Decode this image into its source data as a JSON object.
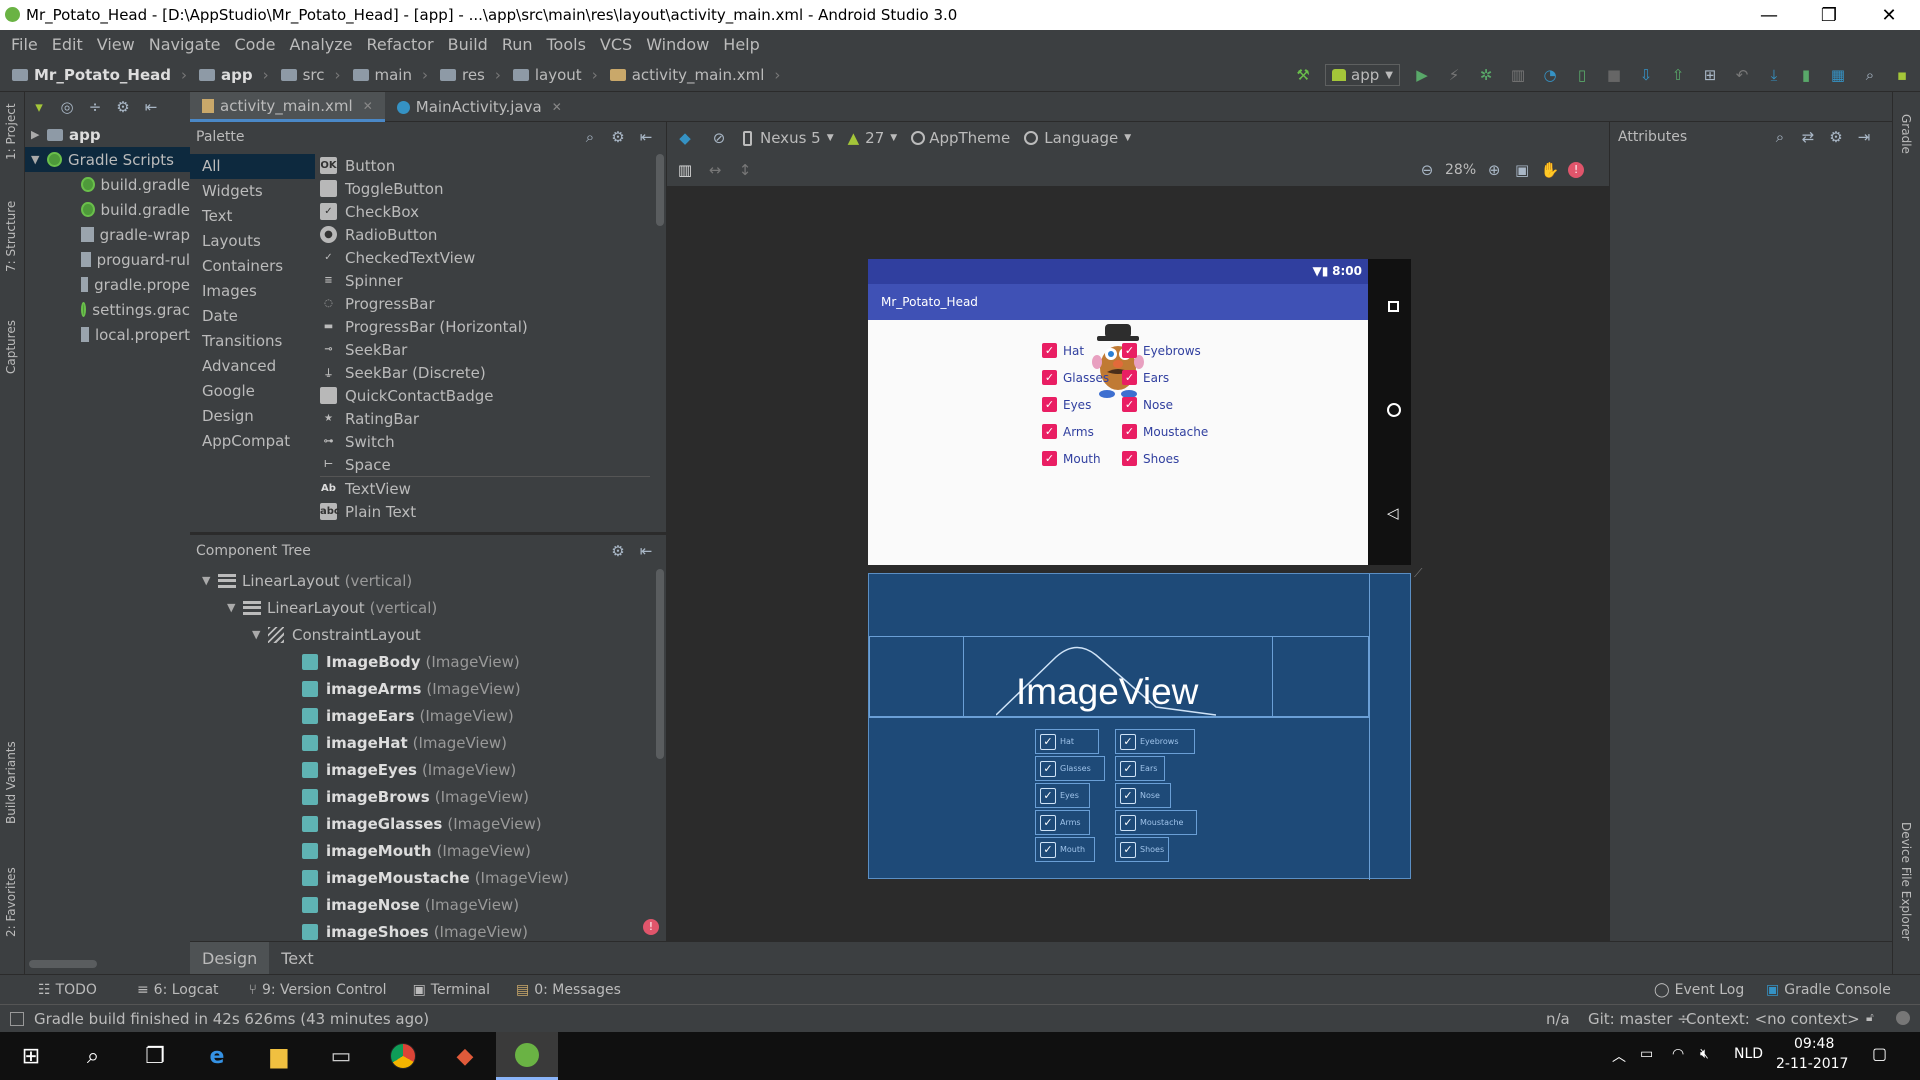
{
  "window": {
    "title": "Mr_Potato_Head - [D:\\AppStudio\\Mr_Potato_Head] - [app] - ...\\app\\src\\main\\res\\layout\\activity_main.xml - Android Studio 3.0",
    "minimize": "—",
    "restore": "❐",
    "close": "✕"
  },
  "menu": [
    "File",
    "Edit",
    "View",
    "Navigate",
    "Code",
    "Analyze",
    "Refactor",
    "Build",
    "Run",
    "Tools",
    "VCS",
    "Window",
    "Help"
  ],
  "breadcrumb": [
    "Mr_Potato_Head",
    "app",
    "src",
    "main",
    "res",
    "layout",
    "activity_main.xml"
  ],
  "run_config": "app",
  "project_tree": {
    "root": "app",
    "gradle_scripts": "Gradle Scripts",
    "files": [
      "build.gradle",
      "build.gradle",
      "gradle-wrap",
      "proguard-rul",
      "gradle.prope",
      "settings.grac",
      "local.propert"
    ]
  },
  "left_strip": {
    "project": "1: Project",
    "structure": "7: Structure",
    "captures": "Captures",
    "build_variants": "Build Variants",
    "favorites": "2: Favorites"
  },
  "right_strip": {
    "gradle": "Gradle",
    "device_explorer": "Device File Explorer"
  },
  "editor_tabs": [
    {
      "label": "activity_main.xml"
    },
    {
      "label": "MainActivity.java"
    }
  ],
  "palette": {
    "title": "Palette",
    "categories": [
      "All",
      "Widgets",
      "Text",
      "Layouts",
      "Containers",
      "Images",
      "Date",
      "Transitions",
      "Advanced",
      "Google",
      "Design",
      "AppCompat"
    ],
    "items": [
      "Button",
      "ToggleButton",
      "CheckBox",
      "RadioButton",
      "CheckedTextView",
      "Spinner",
      "ProgressBar",
      "ProgressBar (Horizontal)",
      "SeekBar",
      "SeekBar (Discrete)",
      "QuickContactBadge",
      "RatingBar",
      "Switch",
      "Space",
      "TextView",
      "Plain Text"
    ]
  },
  "component_tree": {
    "title": "Component Tree",
    "rows": [
      {
        "name": "LinearLayout",
        "type": "(vertical)"
      },
      {
        "name": "LinearLayout",
        "type": "(vertical)"
      },
      {
        "name": "ConstraintLayout",
        "type": ""
      },
      {
        "name": "ImageBody",
        "type": "(ImageView)"
      },
      {
        "name": "imageArms",
        "type": "(ImageView)"
      },
      {
        "name": "imageEars",
        "type": "(ImageView)"
      },
      {
        "name": "imageHat",
        "type": "(ImageView)"
      },
      {
        "name": "imageEyes",
        "type": "(ImageView)"
      },
      {
        "name": "imageBrows",
        "type": "(ImageView)"
      },
      {
        "name": "imageGlasses",
        "type": "(ImageView)"
      },
      {
        "name": "imageMouth",
        "type": "(ImageView)"
      },
      {
        "name": "imageMoustache",
        "type": "(ImageView)"
      },
      {
        "name": "imageNose",
        "type": "(ImageView)"
      },
      {
        "name": "imageShoes",
        "type": "(ImageView)"
      }
    ]
  },
  "design_toolbar": {
    "device": "Nexus 5",
    "api": "27",
    "theme": "AppTheme",
    "language": "Language",
    "zoom": "28%"
  },
  "attributes": {
    "title": "Attributes"
  },
  "preview": {
    "time": "8:00",
    "app_title": "Mr_Potato_Head",
    "checkboxes_left": [
      "Hat",
      "Glasses",
      "Eyes",
      "Arms",
      "Mouth"
    ],
    "checkboxes_right": [
      "Eyebrows",
      "Ears",
      "Nose",
      "Moustache",
      "Shoes"
    ],
    "blueprint_label": "ImageView"
  },
  "design_tabs": [
    "Design",
    "Text"
  ],
  "tool_windows": {
    "left": [
      "TODO",
      "6: Logcat",
      "9: Version Control",
      "Terminal",
      "0: Messages"
    ],
    "right": [
      "Event Log",
      "Gradle Console"
    ]
  },
  "status": {
    "message": "Gradle build finished in 42s 626ms (43 minutes ago)",
    "na": "n/a",
    "git": "Git: master ÷",
    "context": "Context: <no context>"
  },
  "taskbar": {
    "lang": "NLD",
    "time": "09:48",
    "date": "2-11-2017"
  },
  "colors": {
    "accent": "#3f51b5",
    "checkbox": "#e91e63",
    "blueprint": "#1e4a78"
  }
}
